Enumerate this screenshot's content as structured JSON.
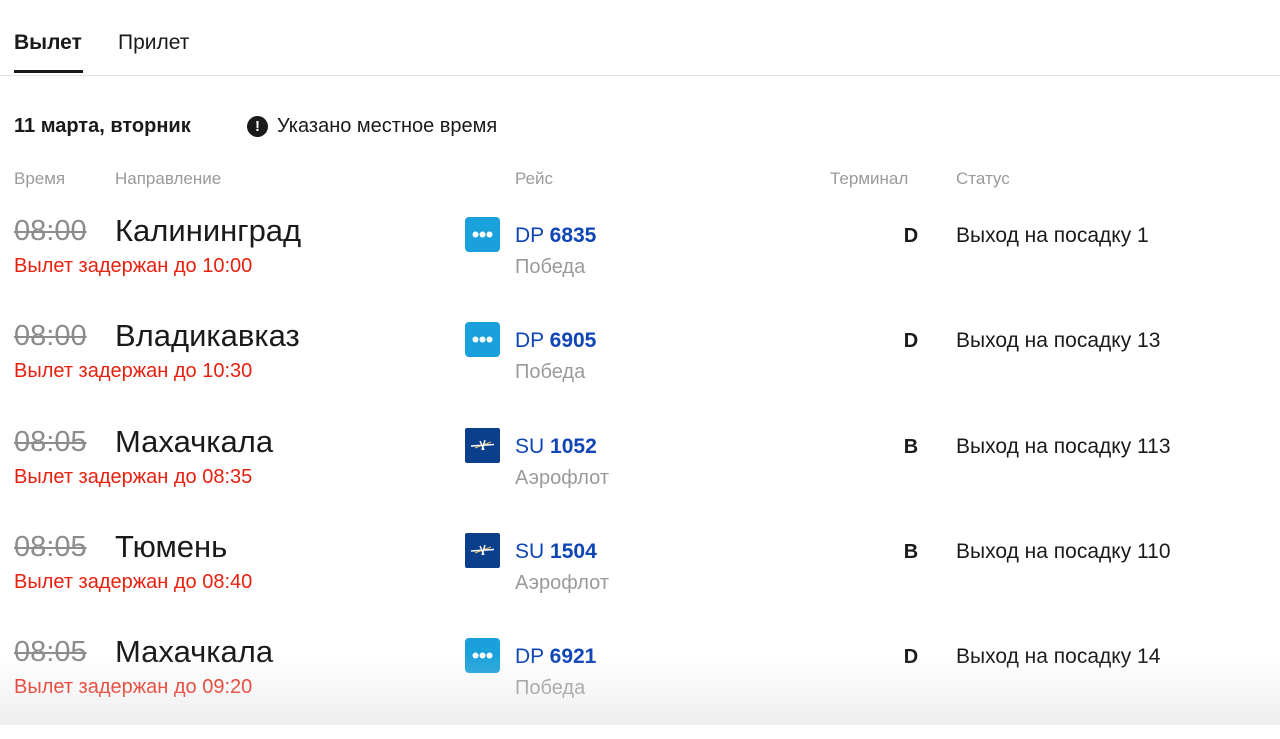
{
  "tabs": [
    {
      "label": "Вылет",
      "active": true
    },
    {
      "label": "Прилет",
      "active": false
    }
  ],
  "date_label": "11 марта, вторник",
  "note": {
    "icon": "exclamation-icon",
    "text": "Указано местное время"
  },
  "columns": {
    "time": "Время",
    "direction": "Направление",
    "flight": "Рейс",
    "terminal": "Терминал",
    "status": "Статус"
  },
  "colors": {
    "delay": "#e8200e",
    "flight_link": "#0f45b5",
    "pobeda": "#1aa1dc",
    "aeroflot": "#0b3f8c"
  },
  "flights": [
    {
      "scheduled": "08:00",
      "destination": "Калининград",
      "delay_text": "Вылет задержан до 10:00",
      "airline_logo": "pobeda",
      "flight_prefix": "DP",
      "flight_number": "6835",
      "carrier": "Победа",
      "terminal": "D",
      "status": "Выход на посадку 1"
    },
    {
      "scheduled": "08:00",
      "destination": "Владикавказ",
      "delay_text": "Вылет задержан до 10:30",
      "airline_logo": "pobeda",
      "flight_prefix": "DP",
      "flight_number": "6905",
      "carrier": "Победа",
      "terminal": "D",
      "status": "Выход на посадку 13"
    },
    {
      "scheduled": "08:05",
      "destination": "Махачкала",
      "delay_text": "Вылет задержан до 08:35",
      "airline_logo": "aeroflot",
      "flight_prefix": "SU",
      "flight_number": "1052",
      "carrier": "Аэрофлот",
      "terminal": "B",
      "status": "Выход на посадку 113"
    },
    {
      "scheduled": "08:05",
      "destination": "Тюмень",
      "delay_text": "Вылет задержан до 08:40",
      "airline_logo": "aeroflot",
      "flight_prefix": "SU",
      "flight_number": "1504",
      "carrier": "Аэрофлот",
      "terminal": "B",
      "status": "Выход на посадку 110"
    },
    {
      "scheduled": "08:05",
      "destination": "Махачкала",
      "delay_text": "Вылет задержан до 09:20",
      "airline_logo": "pobeda",
      "flight_prefix": "DP",
      "flight_number": "6921",
      "carrier": "Победа",
      "terminal": "D",
      "status": "Выход на посадку 14"
    }
  ]
}
